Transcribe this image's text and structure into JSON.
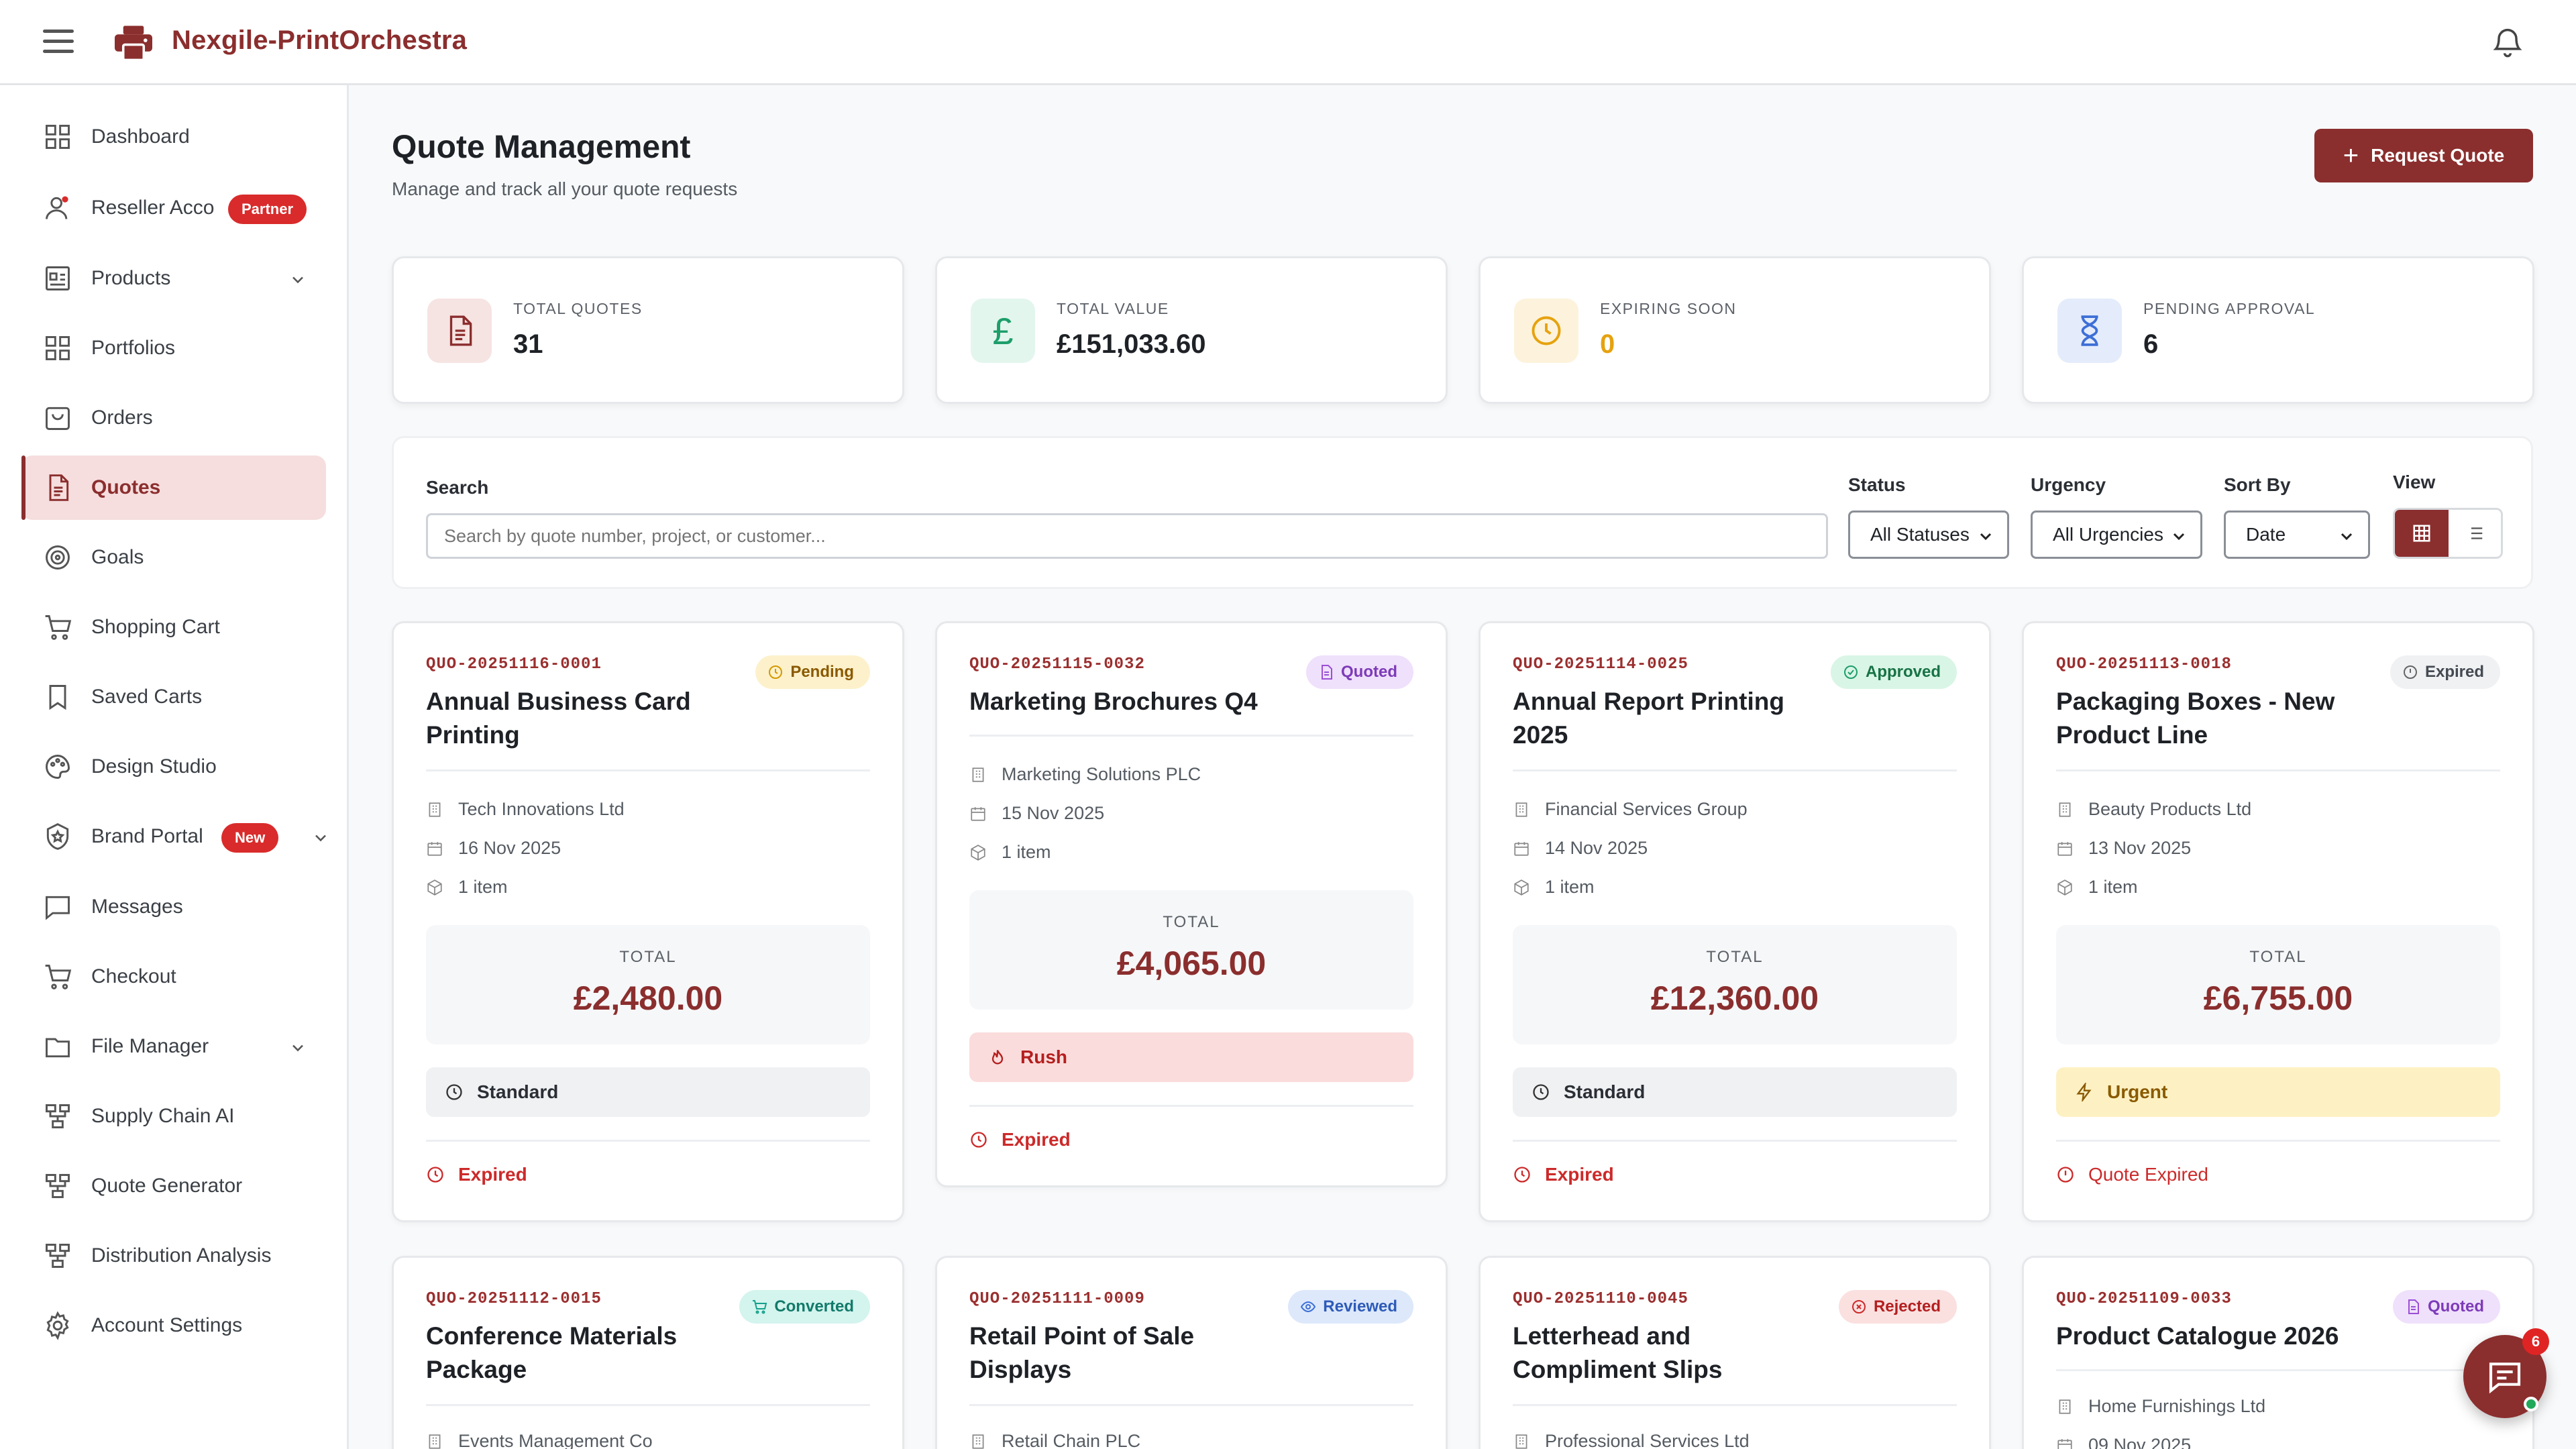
{
  "app": {
    "name": "Nexgile-PrintOrchestra"
  },
  "sidebar": {
    "items": [
      {
        "label": "Dashboard"
      },
      {
        "label": "Reseller Acco",
        "badge": "Partner"
      },
      {
        "label": "Products"
      },
      {
        "label": "Portfolios"
      },
      {
        "label": "Orders"
      },
      {
        "label": "Quotes"
      },
      {
        "label": "Goals"
      },
      {
        "label": "Shopping Cart"
      },
      {
        "label": "Saved Carts"
      },
      {
        "label": "Design Studio"
      },
      {
        "label": "Brand Portal",
        "badge": "New"
      },
      {
        "label": "Messages"
      },
      {
        "label": "Checkout"
      },
      {
        "label": "File Manager"
      },
      {
        "label": "Supply Chain AI"
      },
      {
        "label": "Quote Generator"
      },
      {
        "label": "Distribution Analysis"
      },
      {
        "label": "Account Settings"
      }
    ]
  },
  "page": {
    "title": "Quote Management",
    "subtitle": "Manage and track all your quote requests",
    "request_button": "Request Quote"
  },
  "stats": [
    {
      "label": "TOTAL QUOTES",
      "value": "31",
      "color": "#8b2e2e",
      "bg": "#f6e4e2"
    },
    {
      "label": "TOTAL VALUE",
      "value": "£151,033.60",
      "color": "#1e9e6a",
      "bg": "#e3f6ee"
    },
    {
      "label": "EXPIRING SOON",
      "value": "0",
      "color": "#e6a20f",
      "bg": "#fdf3dc"
    },
    {
      "label": "PENDING APPROVAL",
      "value": "6",
      "color": "#3d6fd6",
      "bg": "#e4ecfb"
    }
  ],
  "filters": {
    "search_label": "Search",
    "search_placeholder": "Search by quote number, project, or customer...",
    "status_label": "Status",
    "status_value": "All Statuses",
    "urgency_label": "Urgency",
    "urgency_value": "All Urgencies",
    "sort_label": "Sort By",
    "sort_value": "Date",
    "view_label": "View"
  },
  "quotes": [
    {
      "number": "QUO-20251116-0001",
      "title": "Annual Business Card Printing",
      "status": "Pending",
      "customer": "Tech Innovations Ltd",
      "date": "16 Nov 2025",
      "items": "1 item",
      "total_label": "TOTAL",
      "total": "£2,480.00",
      "urgency": "Standard",
      "expiry": "Expired"
    },
    {
      "number": "QUO-20251115-0032",
      "title": "Marketing Brochures Q4",
      "status": "Quoted",
      "customer": "Marketing Solutions PLC",
      "date": "15 Nov 2025",
      "items": "1 item",
      "total_label": "TOTAL",
      "total": "£4,065.00",
      "urgency": "Rush",
      "expiry": "Expired"
    },
    {
      "number": "QUO-20251114-0025",
      "title": "Annual Report Printing 2025",
      "status": "Approved",
      "customer": "Financial Services Group",
      "date": "14 Nov 2025",
      "items": "1 item",
      "total_label": "TOTAL",
      "total": "£12,360.00",
      "urgency": "Standard",
      "expiry": "Expired"
    },
    {
      "number": "QUO-20251113-0018",
      "title": "Packaging Boxes - New Product Line",
      "status": "Expired",
      "customer": "Beauty Products Ltd",
      "date": "13 Nov 2025",
      "items": "1 item",
      "total_label": "TOTAL",
      "total": "£6,755.00",
      "urgency": "Urgent",
      "expiry": "Quote Expired"
    },
    {
      "number": "QUO-20251112-0015",
      "title": "Conference Materials Package",
      "status": "Converted",
      "customer": "Events Management Co"
    },
    {
      "number": "QUO-20251111-0009",
      "title": "Retail Point of Sale Displays",
      "status": "Reviewed",
      "customer": "Retail Chain PLC"
    },
    {
      "number": "QUO-20251110-0045",
      "title": "Letterhead and Compliment Slips",
      "status": "Rejected",
      "customer": "Professional Services Ltd"
    },
    {
      "number": "QUO-20251109-0033",
      "title": "Product Catalogue 2026",
      "status": "Quoted",
      "customer": "Home Furnishings Ltd",
      "date": "09 Nov 2025"
    }
  ],
  "chat": {
    "count": "6"
  }
}
